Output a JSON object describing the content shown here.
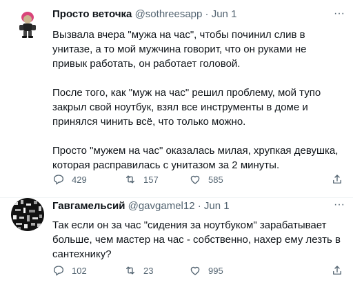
{
  "tweets": [
    {
      "author_name": "Просто веточка",
      "handle": "@sothreesapp",
      "date": "Jun 1",
      "paragraphs": [
        "Вызвала вчера \"мужа на час\", чтобы починил слив в унитазе, а то мой мужчина говорит, что он руками не привык работать, он работает головой.",
        "После того, как \"муж на час\" решил проблему, мой тупо закрыл свой ноутбук, взял все инструменты в доме и принялся чинить всё, что только можно.",
        "Просто \"мужем на час\" оказалась милая, хрупкая девушка, которая расправилась с унитазом за 2 минуты."
      ],
      "replies": "429",
      "retweets": "157",
      "likes": "585",
      "avatar": "cartoon-character-avatar"
    },
    {
      "author_name": "Гавгамельсий",
      "handle": "@gavgamel12",
      "date": "Jun 1",
      "paragraphs": [
        "Так если он за час \"сидения за ноутбуком\" зарабатывает больше, чем мастер на час - собственно, нахер ему лезть в сантехнику?"
      ],
      "replies": "102",
      "retweets": "23",
      "likes": "995",
      "avatar": "noise-pattern-avatar"
    }
  ],
  "separator": " · ",
  "more_glyph": "···",
  "colors": {
    "text": "#0f1419",
    "secondary": "#536471",
    "divider": "#eff3f4"
  }
}
